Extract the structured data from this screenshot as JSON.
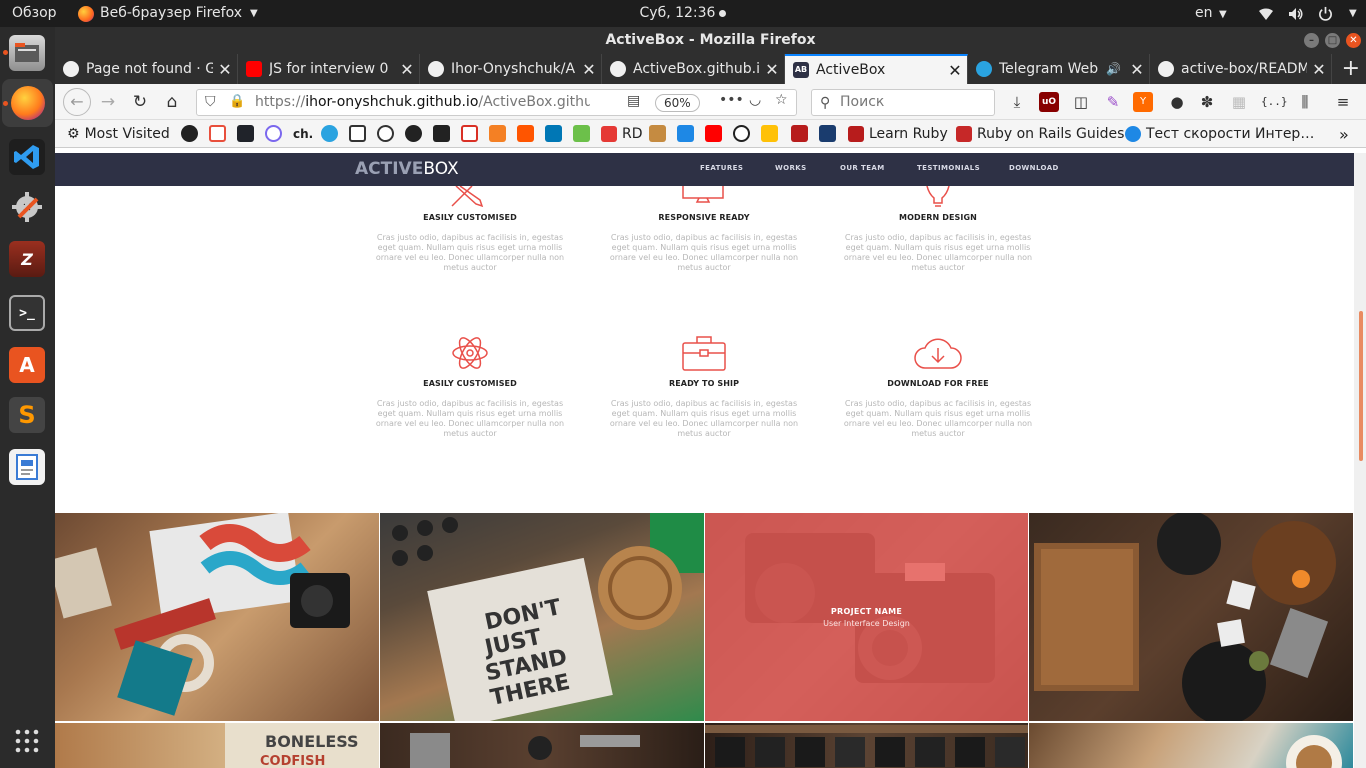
{
  "system": {
    "activities": "Обзор",
    "app_menu": "Веб-браузер Firefox",
    "clock": "Суб, 12:36",
    "language": "en"
  },
  "window": {
    "title": "ActiveBox - Mozilla Firefox"
  },
  "tabs": [
    {
      "label": "Page not found · G",
      "icon": "github-icon"
    },
    {
      "label": "JS for interview 0",
      "icon": "youtube-icon"
    },
    {
      "label": "Ihor-Onyshchuk/A",
      "icon": "github-icon"
    },
    {
      "label": "ActiveBox.github.i",
      "icon": "github-icon"
    },
    {
      "label": "ActiveBox",
      "icon": "activebox-icon",
      "active": true
    },
    {
      "label": "Telegram Web",
      "icon": "telegram-icon",
      "audio": true
    },
    {
      "label": "active-box/READM",
      "icon": "github-icon"
    }
  ],
  "navbar": {
    "url_prefix": "https://",
    "url_host": "ihor-onyshchuk.github.io",
    "url_path": "/ActiveBox.github.",
    "zoom": "60%",
    "search_placeholder": "Поиск"
  },
  "bookmarks": {
    "most_visited": "Most Visited",
    "rd": "RD",
    "learn_ruby": "Learn Ruby",
    "rails_guides": "Ruby on Rails Guides",
    "speed_test": "Тест скорости Интер…",
    "ch": "ch."
  },
  "site": {
    "logo_bold": "ACTIVE",
    "logo_thin": "BOX",
    "nav": [
      "FEATURES",
      "WORKS",
      "OUR TEAM",
      "TESTIMONIALS",
      "DOWNLOAD"
    ],
    "features": [
      {
        "title": "EASILY CUSTOMISED",
        "icon": "pencil-ruler-icon",
        "text": "Cras justo odio, dapibus ac facilisis in, egestas eget quam. Nullam quis risus eget urna mollis ornare vel eu leo. Donec ullamcorper nulla non metus auctor"
      },
      {
        "title": "RESPONSIVE READY",
        "icon": "monitor-icon",
        "text": "Cras justo odio, dapibus ac facilisis in, egestas eget quam. Nullam quis risus eget urna mollis ornare vel eu leo. Donec ullamcorper nulla non metus auctor"
      },
      {
        "title": "MODERN DESIGN",
        "icon": "lightbulb-icon",
        "text": "Cras justo odio, dapibus ac facilisis in, egestas eget quam. Nullam quis risus eget urna mollis ornare vel eu leo. Donec ullamcorper nulla non metus auctor"
      },
      {
        "title": "EASILY CUSTOMISED",
        "icon": "atom-icon",
        "text": "Cras justo odio, dapibus ac facilisis in, egestas eget quam. Nullam quis risus eget urna mollis ornare vel eu leo. Donec ullamcorper nulla non metus auctor"
      },
      {
        "title": "READY TO SHIP",
        "icon": "briefcase-icon",
        "text": "Cras justo odio, dapibus ac facilisis in, egestas eget quam. Nullam quis risus eget urna mollis ornare vel eu leo. Donec ullamcorper nulla non metus auctor"
      },
      {
        "title": "DOWNLOAD FOR FREE",
        "icon": "cloud-download-icon",
        "text": "Cras justo odio, dapibus ac facilisis in, egestas eget quam. Nullam quis risus eget urna mollis ornare vel eu leo. Donec ullamcorper nulla non metus auctor"
      }
    ],
    "portfolio_hover": {
      "name": "PROJECT NAME",
      "category": "User Interface Design"
    },
    "accent": "#e9504a",
    "nav_bg": "#2e3145"
  }
}
